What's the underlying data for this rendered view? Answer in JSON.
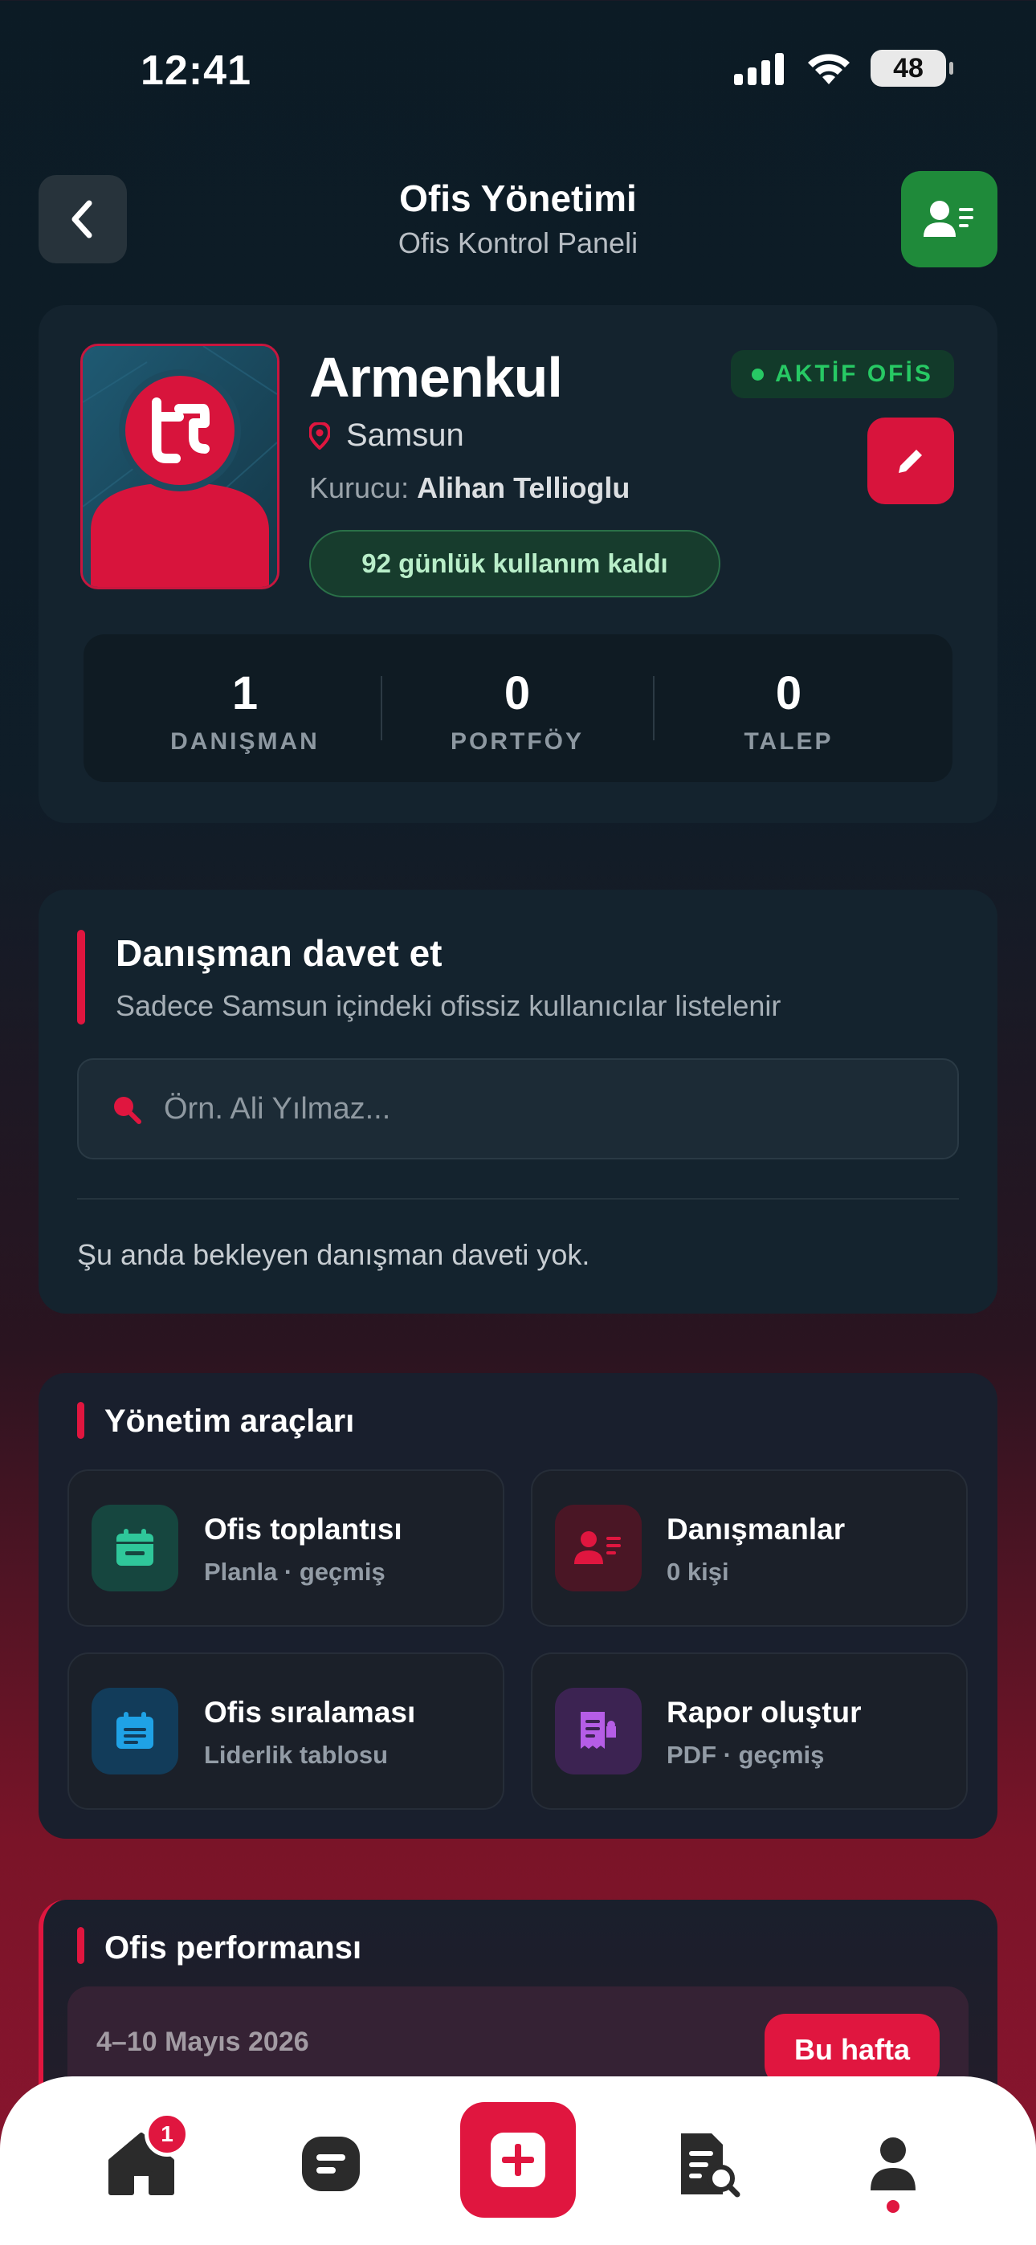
{
  "status_bar": {
    "time": "12:41",
    "battery": "48"
  },
  "header": {
    "title": "Ofis Yönetimi",
    "subtitle": "Ofis Kontrol Paneli"
  },
  "office": {
    "name": "Armenkul",
    "status_badge": "AKTİF OFİS",
    "city": "Samsun",
    "founder_label": "Kurucu:",
    "founder_name": "Alihan Tellioglu",
    "days_left": "92 günlük kullanım kaldı",
    "stats": [
      {
        "value": "1",
        "label": "DANIŞMAN"
      },
      {
        "value": "0",
        "label": "PORTFÖY"
      },
      {
        "value": "0",
        "label": "TALEP"
      }
    ]
  },
  "invite": {
    "title": "Danışman davet et",
    "subtitle": "Sadece Samsun içindeki ofissiz kullanıcılar listelenir",
    "search_placeholder": "Örn. Ali Yılmaz...",
    "empty_text": "Şu anda bekleyen danışman daveti yok."
  },
  "tools": {
    "title": "Yönetim araçları",
    "items": [
      {
        "title": "Ofis toplantısı",
        "subtitle": "Planla · geçmiş",
        "icon": "calendar-icon"
      },
      {
        "title": "Danışmanlar",
        "subtitle": "0 kişi",
        "icon": "contact-card-icon"
      },
      {
        "title": "Ofis sıralaması",
        "subtitle": "Liderlik tablosu",
        "icon": "leaderboard-icon"
      },
      {
        "title": "Rapor oluştur",
        "subtitle": "PDF · geçmiş",
        "icon": "report-icon"
      }
    ]
  },
  "performance": {
    "title": "Ofis performansı",
    "range": "4–10 Mayıs 2026",
    "week_button": "Bu hafta"
  },
  "bottom_nav": {
    "home_badge": "1",
    "items": [
      "home-icon",
      "chat-icon",
      "add-icon",
      "document-search-icon",
      "profile-icon"
    ]
  },
  "colors": {
    "accent": "#e0163f",
    "success": "#27c964",
    "contact_green": "#1f8a3a"
  }
}
